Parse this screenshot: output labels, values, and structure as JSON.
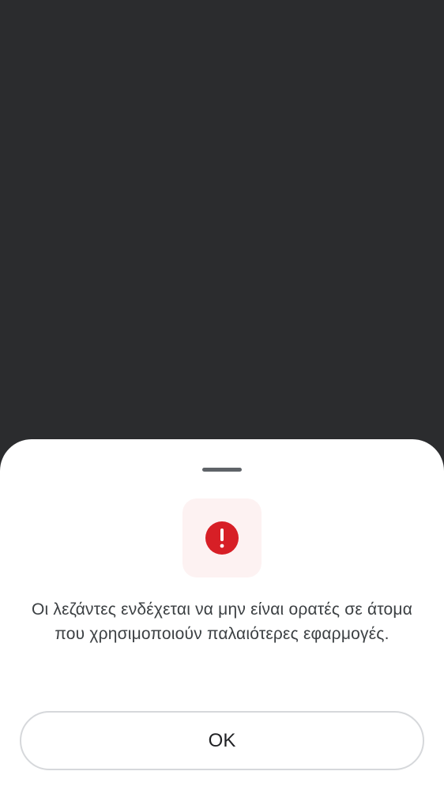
{
  "dialog": {
    "message": "Οι λεζάντες ενδέχεται να μην είναι ορατές σε άτομα που χρησιμοποιούν παλαιότερες εφαρμογές.",
    "ok_label": "OK",
    "icon": "error-alert-icon"
  },
  "colors": {
    "backdrop": "#2b2c2e",
    "sheet": "#ffffff",
    "alert_red": "#d71f26",
    "alert_tile": "#fdf2f2"
  }
}
